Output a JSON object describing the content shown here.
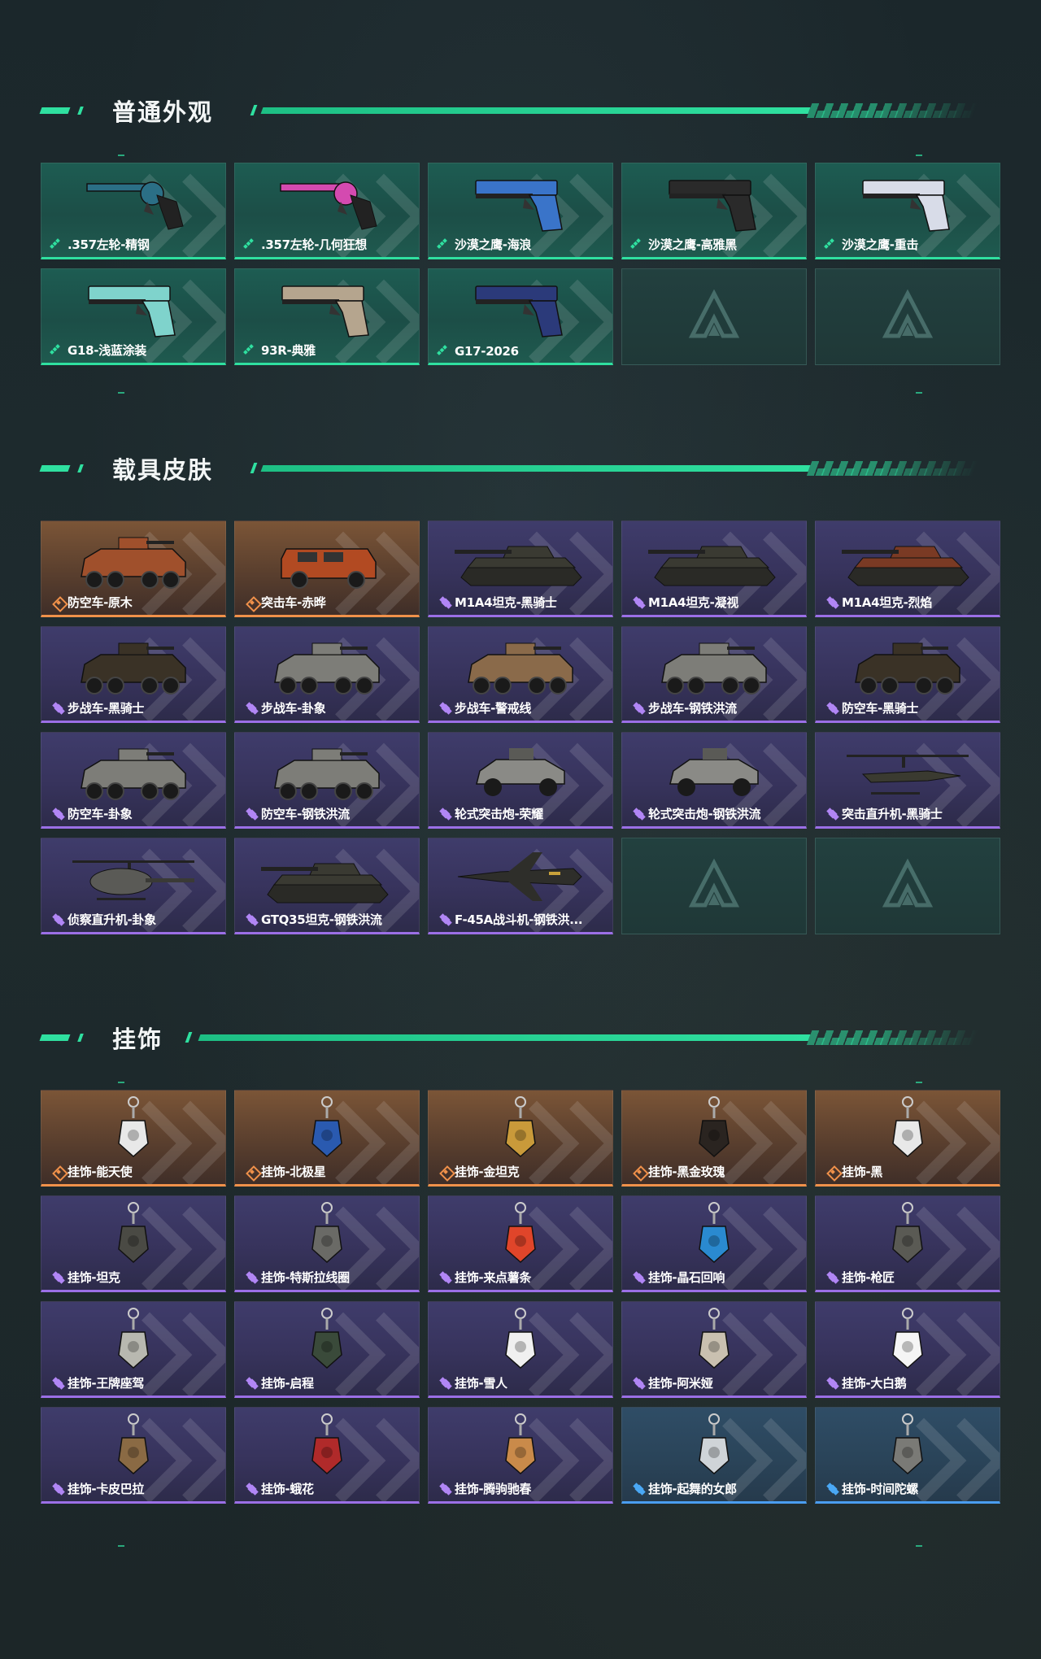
{
  "colors": {
    "accent": "#2fe0a0",
    "green_rarity": "#2fe0a0",
    "orange_rarity": "#f0914a",
    "purple_rarity": "#9b6fe6",
    "blue_rarity": "#4a9df0"
  },
  "sections": [
    {
      "title": "普通外观",
      "items": [
        {
          "label": ".357左轮-精钢",
          "rarity": "green",
          "icon": "revolver-teal"
        },
        {
          "label": ".357左轮-几何狂想",
          "rarity": "green",
          "icon": "revolver-pink"
        },
        {
          "label": "沙漠之鹰-海浪",
          "rarity": "green",
          "icon": "pistol-blue"
        },
        {
          "label": "沙漠之鹰-高雅黑",
          "rarity": "green",
          "icon": "pistol-black"
        },
        {
          "label": "沙漠之鹰-重击",
          "rarity": "green",
          "icon": "pistol-white"
        },
        {
          "label": "G18-浅蓝涂装",
          "rarity": "green",
          "icon": "pistol-cyan"
        },
        {
          "label": "93R-典雅",
          "rarity": "green",
          "icon": "pistol-tan"
        },
        {
          "label": "G17-2026",
          "rarity": "green",
          "icon": "pistol-navy"
        },
        {
          "label": "",
          "rarity": "empty",
          "icon": "empty-slot"
        },
        {
          "label": "",
          "rarity": "empty",
          "icon": "empty-slot"
        }
      ]
    },
    {
      "title": "载具皮肤",
      "items": [
        {
          "label": "防空车-原木",
          "rarity": "orange",
          "icon": "apc-orange"
        },
        {
          "label": "突击车-赤晔",
          "rarity": "orange",
          "icon": "truck-orange"
        },
        {
          "label": "M1A4坦克-黑骑士",
          "rarity": "purple",
          "icon": "tank-dark"
        },
        {
          "label": "M1A4坦克-凝视",
          "rarity": "purple",
          "icon": "tank-dark"
        },
        {
          "label": "M1A4坦克-烈焰",
          "rarity": "purple",
          "icon": "tank-red"
        },
        {
          "label": "步战车-黑骑士",
          "rarity": "purple",
          "icon": "apc-dark"
        },
        {
          "label": "步战车-卦象",
          "rarity": "purple",
          "icon": "apc-grey"
        },
        {
          "label": "步战车-警戒线",
          "rarity": "purple",
          "icon": "apc-camo"
        },
        {
          "label": "步战车-钢铁洪流",
          "rarity": "purple",
          "icon": "apc-grey"
        },
        {
          "label": "防空车-黑骑士",
          "rarity": "purple",
          "icon": "apc-dark"
        },
        {
          "label": "防空车-卦象",
          "rarity": "purple",
          "icon": "apc-grey"
        },
        {
          "label": "防空车-钢铁洪流",
          "rarity": "purple",
          "icon": "apc-grey"
        },
        {
          "label": "轮式突击炮-荣耀",
          "rarity": "purple",
          "icon": "buggy-grey"
        },
        {
          "label": "轮式突击炮-钢铁洪流",
          "rarity": "purple",
          "icon": "buggy-grey"
        },
        {
          "label": "突击直升机-黑骑士",
          "rarity": "purple",
          "icon": "helicopter-attack"
        },
        {
          "label": "侦察直升机-卦象",
          "rarity": "purple",
          "icon": "helicopter-scout"
        },
        {
          "label": "GTQ35坦克-钢铁洪流",
          "rarity": "purple",
          "icon": "tank-dark"
        },
        {
          "label": "F-45A战斗机-钢铁洪...",
          "rarity": "purple",
          "icon": "jet-fighter"
        },
        {
          "label": "",
          "rarity": "empty",
          "icon": "empty-slot"
        },
        {
          "label": "",
          "rarity": "empty",
          "icon": "empty-slot"
        }
      ]
    },
    {
      "title": "挂饰",
      "items": [
        {
          "label": "挂饰-能天使",
          "rarity": "orange",
          "icon": "charm-tag"
        },
        {
          "label": "挂饰-北极星",
          "rarity": "orange",
          "icon": "charm-star"
        },
        {
          "label": "挂饰-金坦克",
          "rarity": "orange",
          "icon": "charm-gold"
        },
        {
          "label": "挂饰-黑金玫瑰",
          "rarity": "orange",
          "icon": "charm-rose"
        },
        {
          "label": "挂饰-黑",
          "rarity": "orange",
          "icon": "charm-tag"
        },
        {
          "label": "挂饰-坦克",
          "rarity": "purple",
          "icon": "charm-tank"
        },
        {
          "label": "挂饰-特斯拉线圈",
          "rarity": "purple",
          "icon": "charm-coil"
        },
        {
          "label": "挂饰-来点薯条",
          "rarity": "purple",
          "icon": "charm-fries"
        },
        {
          "label": "挂饰-晶石回响",
          "rarity": "purple",
          "icon": "charm-crystal"
        },
        {
          "label": "挂饰-枪匠",
          "rarity": "purple",
          "icon": "charm-gunsmith"
        },
        {
          "label": "挂饰-王牌座驾",
          "rarity": "purple",
          "icon": "charm-plane"
        },
        {
          "label": "挂饰-启程",
          "rarity": "purple",
          "icon": "charm-round"
        },
        {
          "label": "挂饰-雪人",
          "rarity": "purple",
          "icon": "charm-snowman"
        },
        {
          "label": "挂饰-阿米娅",
          "rarity": "purple",
          "icon": "charm-rabbit"
        },
        {
          "label": "挂饰-大白鹅",
          "rarity": "purple",
          "icon": "charm-goose"
        },
        {
          "label": "挂饰-卡皮巴拉",
          "rarity": "purple",
          "icon": "charm-capybara"
        },
        {
          "label": "挂饰-蛾花",
          "rarity": "purple",
          "icon": "charm-flower"
        },
        {
          "label": "挂饰-腾驹驰春",
          "rarity": "purple",
          "icon": "charm-carriage"
        },
        {
          "label": "挂饰-起舞的女郎",
          "rarity": "blue",
          "icon": "charm-dancer"
        },
        {
          "label": "挂饰-时间陀螺",
          "rarity": "blue",
          "icon": "charm-top"
        }
      ]
    }
  ]
}
